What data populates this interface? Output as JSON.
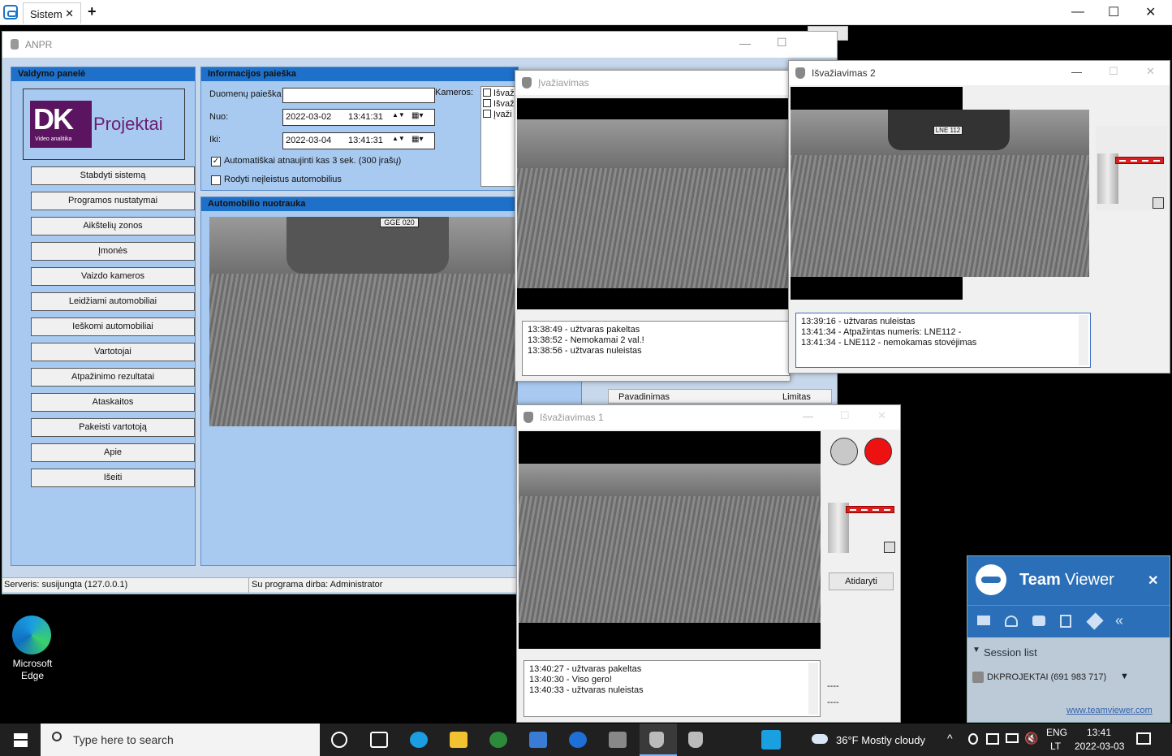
{
  "outer": {
    "tab_label": "Sistem",
    "tab_close": "✕",
    "new_tab": "+",
    "min": "—",
    "max": "☐",
    "close": "✕"
  },
  "anpr": {
    "title": "ANPR",
    "control_panel": {
      "header": "Valdymo panelė",
      "logo_dk": "DK",
      "logo_name": "Projektai",
      "logo_sub": "Video analitika",
      "buttons": [
        "Stabdyti sistemą",
        "Programos nustatymai",
        "Aikštelių zonos",
        "Įmonės",
        "Vaizdo kameros",
        "Leidžiami automobiliai",
        "Ieškomi automobiliai",
        "Vartotojai",
        "Atpažinimo rezultatai",
        "Ataskaitos",
        "Pakeisti vartotoją",
        "Apie",
        "Išeiti"
      ]
    },
    "search": {
      "header": "Informacijos paieška",
      "data_search_label": "Duomenų paieška",
      "from_label": "Nuo:",
      "from_date": "2022-03-02",
      "from_time": "13:41:31",
      "to_label": "Iki:",
      "to_date": "2022-03-04",
      "to_time": "13:41:31",
      "cameras_label": "Kameros:",
      "camera_items": [
        "Išvaž",
        "Išvaž",
        "Įvaži"
      ],
      "auto_refresh_label": "Automatiškai atnaujinti kas 3 sek. (300 įrašų)",
      "show_unauthorized_label": "Rodyti neįleistus automobilius"
    },
    "photo_header": "Automobilio nuotrauka",
    "plate_text": "GGE 020",
    "columns": {
      "name": "Pavadinimas",
      "limit": "Limitas"
    },
    "status": {
      "server": "Serveris: susijungta (127.0.0.1)",
      "user": "Su programa dirba: Administrator"
    }
  },
  "entry_window": {
    "title": "Įvažiavimas",
    "log": [
      "13:38:49 - užtvaras pakeltas",
      "13:38:52 - Nemokamai 2 val.!",
      "13:38:56 - užtvaras nuleistas"
    ]
  },
  "exit2_window": {
    "title": "Išvažiavimas 2",
    "plate_text": "LNE 112",
    "log": [
      "13:39:16 - užtvaras nuleistas",
      "13:41:34 - Atpažintas numeris: LNE112 -",
      "13:41:34 - LNE112 -  nemokamas stovėjimas"
    ]
  },
  "exit1_window": {
    "title": "Išvažiavimas 1",
    "open_button": "Atidaryti",
    "log": [
      "13:40:27 - užtvaras pakeltas",
      "13:40:30 - Viso gero!",
      "13:40:33 - užtvaras nuleistas"
    ],
    "dashes": [
      "----",
      "----"
    ],
    "lights": {
      "left": "#c8c8c8",
      "right": "#ee1111"
    }
  },
  "desktop": {
    "edge_label_1": "Microsoft",
    "edge_label_2": "Edge"
  },
  "teamviewer": {
    "brand_bold": "Team",
    "brand_light": "Viewer",
    "close": "✕",
    "session_list": "Session list",
    "session_item": "DKPROJEKTAI (691 983 717)",
    "link": "www.teamviewer.com"
  },
  "taskbar": {
    "search_placeholder": "Type here to search",
    "weather": "36°F  Mostly cloudy",
    "lang_1": "ENG",
    "lang_2": "LT",
    "time": "13:41",
    "date": "2022-03-03"
  }
}
